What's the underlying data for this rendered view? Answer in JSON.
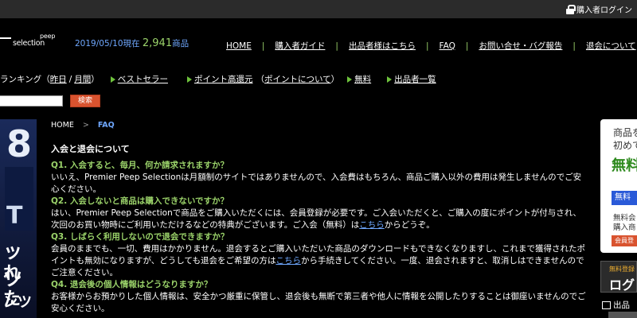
{
  "header": {
    "buyer_login": "購入者ログイン"
  },
  "logo": {
    "line1": "peep",
    "line2": "selection"
  },
  "stats": {
    "date_prefix": "2019/05/10現在",
    "count": "2,941",
    "unit": "商品"
  },
  "nav": {
    "items": [
      {
        "label": "HOME"
      },
      {
        "label": "購入者ガイド"
      },
      {
        "label": "出品者様はこちら"
      },
      {
        "label": "FAQ"
      },
      {
        "label": "お問い合せ・バグ報告"
      },
      {
        "label": "退会について"
      }
    ]
  },
  "subnav": {
    "ranking_label": "ランキング",
    "ranking_yesterday": "昨日",
    "ranking_slash": "/",
    "ranking_month": "月間",
    "bestseller": "ベストセラー",
    "points_high": "ポイント高還元",
    "points_about": "ポイントについて",
    "free": "無料",
    "seller_list": "出品者一覧"
  },
  "search": {
    "placeholder": "",
    "button_label": "検索"
  },
  "left_banner": {
    "t1": "8",
    "t2": "T",
    "t3": "ッツ",
    "t4": "れた",
    "t5": "ンツ"
  },
  "breadcrumb": {
    "home": "HOME",
    "sep": ">",
    "current": "FAQ"
  },
  "faq": {
    "heading": "入会と退会について",
    "items": [
      {
        "q": "Q1. 入会すると、毎月、何か請求されますか？",
        "a": "いいえ、Premier Peep Selectionは月額制のサイトではありませんので、入会費はもちろん、商品ご購入以外の費用は発生しませんのでご安心ください。"
      },
      {
        "q": "Q2. 入会しないと商品は購入できないですか？",
        "a_pre": "はい、Premier Peep Selectionで商品をご購入いただくには、会員登録が必要です。ご入会いただくと、ご購入の度にポイントが付与され、次回のお買い物時にご利用いただけるなどの特典がございます。ご入会（無料）は",
        "a_link": "こちら",
        "a_post": "からどうぞ。"
      },
      {
        "q": "Q3. しばらく利用しないので退会できますか？",
        "a_pre": "会員のままでも、一切、費用はかかりません。退会するとご購入いただいた商品のダウンロードもできなくなりますし、これまで獲得されたポイントも無効になりますが、どうしても退会をご希望の方は",
        "a_link": "こちら",
        "a_post": "から手続きしてください。一度、退会されますと、取消しはできませんのでご注意ください。"
      },
      {
        "q": "Q4. 退会後の個人情報はどうなりますか？",
        "a": "お客様からお預かりした個人情報は、安全かつ厳重に保管し、退会後も無断で第三者や他人に情報を公開したりすることは御座いませんのでご安心ください。"
      }
    ]
  },
  "right_panel": {
    "line1": "商品を",
    "line2": "初めて",
    "line3": "無料",
    "badge": "無料",
    "line4": "無料会",
    "line5": "購入商",
    "button": "会員登"
  },
  "login_panel": {
    "line1": "無料登録",
    "line2": "ログ"
  },
  "seller_link": {
    "label": "出品"
  }
}
